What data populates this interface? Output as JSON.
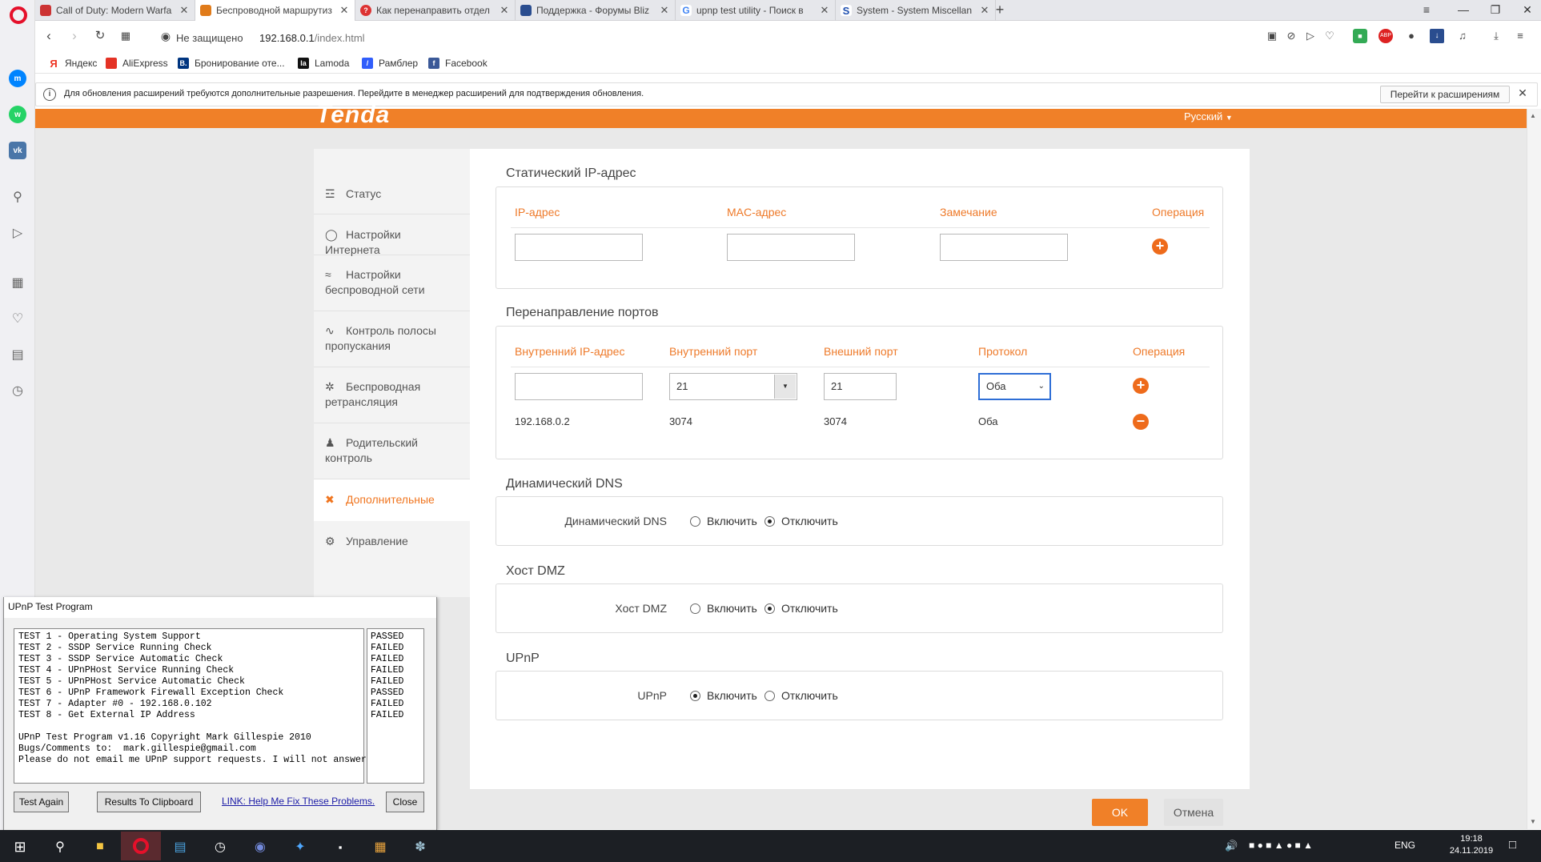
{
  "browser": {
    "tabs": [
      {
        "title": "Call of Duty: Modern Warfa",
        "favicon": "cod-icon",
        "color": "#c33"
      },
      {
        "title": "Беспроводной маршрутиз",
        "favicon": "router-icon",
        "color": "#e07b1a"
      },
      {
        "title": "Как перенаправить отдел",
        "favicon": "question-icon",
        "color": "#d33"
      },
      {
        "title": "Поддержка - Форумы Bliz",
        "favicon": "blizzard-icon",
        "color": "#2a4d8f"
      },
      {
        "title": "upnp test utility - Поиск в",
        "favicon": "google-icon",
        "color": "#4285f4"
      },
      {
        "title": "System - System Miscellan",
        "favicon": "s-icon",
        "color": "#1f4fb0"
      }
    ],
    "security_label": "Не защищено",
    "url_host": "192.168.0.1",
    "url_path": "/index.html",
    "bookmarks": [
      {
        "label": "Яндекс",
        "icon": "yandex-icon",
        "color": "#e32"
      },
      {
        "label": "AliExpress",
        "icon": "aliexpress-icon",
        "color": "#e43225"
      },
      {
        "label": "Бронирование оте...",
        "icon": "booking-icon",
        "color": "#003580"
      },
      {
        "label": "Lamoda",
        "icon": "lamoda-icon",
        "color": "#111"
      },
      {
        "label": "Рамблер",
        "icon": "rambler-icon",
        "color": "#315efb"
      },
      {
        "label": "Facebook",
        "icon": "facebook-icon",
        "color": "#3b5998"
      }
    ],
    "info_text": "Для обновления расширений требуются дополнительные разрешения. Перейдите в менеджер расширений для подтверждения обновления.",
    "info_button": "Перейти к расширениям"
  },
  "router": {
    "brand": "Tenda",
    "language": "Русский",
    "menu": [
      {
        "label": "Статус",
        "icon": "status-icon"
      },
      {
        "label": "Настройки Интернета",
        "icon": "globe-icon"
      },
      {
        "label": "Настройки беспроводной сети",
        "icon": "wifi-icon"
      },
      {
        "label": "Контроль полосы пропускания",
        "icon": "bandwidth-icon"
      },
      {
        "label": "Беспроводная ретрансляция",
        "icon": "antenna-icon"
      },
      {
        "label": "Родительский контроль",
        "icon": "parental-icon"
      },
      {
        "label": "Дополнительные",
        "icon": "tools-icon"
      },
      {
        "label": "Управление",
        "icon": "gears-icon"
      }
    ],
    "static_ip": {
      "title": "Статический IP-адрес",
      "headers": [
        "IP-адрес",
        "MAC-адрес",
        "Замечание",
        "Операция"
      ]
    },
    "port_forward": {
      "title": "Перенаправление портов",
      "headers": [
        "Внутренний IP-адрес",
        "Внутренний порт",
        "Внешний порт",
        "Протокол",
        "Операция"
      ],
      "input_internal_port": "21",
      "input_external_port": "21",
      "input_protocol": "Оба",
      "row": {
        "ip": "192.168.0.2",
        "internal_port": "3074",
        "external_port": "3074",
        "protocol": "Оба"
      }
    },
    "ddns": {
      "title": "Динамический DNS",
      "label": "Динамический DNS",
      "on": "Включить",
      "off": "Отключить",
      "value": "off"
    },
    "dmz": {
      "title": "Хост DMZ",
      "label": "Хост DMZ",
      "on": "Включить",
      "off": "Отключить",
      "value": "off"
    },
    "upnp": {
      "title": "UPnP",
      "label": "UPnP",
      "on": "Включить",
      "off": "Отключить",
      "value": "on"
    },
    "ok_button": "OK",
    "cancel_button": "Отмена"
  },
  "upnp_dialog": {
    "title": "UPnP Test Program",
    "log": "TEST 1 - Operating System Support\nTEST 2 - SSDP Service Running Check\nTEST 3 - SSDP Service Automatic Check\nTEST 4 - UPnPHost Service Running Check\nTEST 5 - UPnPHost Service Automatic Check\nTEST 6 - UPnP Framework Firewall Exception Check\nTEST 7 - Adapter #0 - 192.168.0.102\nTEST 8 - Get External IP Address\n\nUPnP Test Program v1.16 Copyright Mark Gillespie 2010\nBugs/Comments to:  mark.gillespie@gmail.com\nPlease do not email me UPnP support requests. I will not answer them.",
    "results": "PASSED\nFAILED\nFAILED\nFAILED\nFAILED\nPASSED\nFAILED\nFAILED",
    "btn_test_again": "Test Again",
    "btn_clipboard": "Results To Clipboard",
    "link": "LINK: Help Me Fix These Problems.",
    "btn_close": "Close"
  },
  "taskbar": {
    "lang": "ENG",
    "time": "19:18",
    "date": "24.11.2019"
  }
}
